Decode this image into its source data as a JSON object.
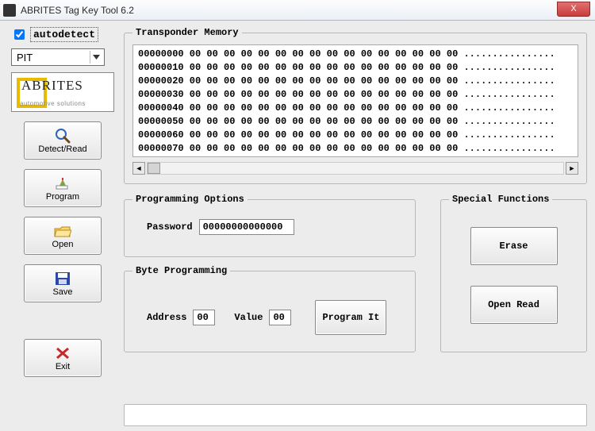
{
  "window": {
    "title": "ABRITES Tag Key Tool 6.2",
    "close": "X"
  },
  "left": {
    "autodetect_label": "autodetect",
    "autodetect_checked": true,
    "combo_value": "PIT",
    "logo_main": "ABRITES",
    "logo_sub": "automotive solutions",
    "buttons": {
      "detect": "Detect/Read",
      "program": "Program",
      "open": "Open",
      "save": "Save",
      "exit": "Exit"
    }
  },
  "memory": {
    "legend": "Transponder Memory",
    "rows": [
      "00000000 00 00 00 00 00 00 00 00 00 00 00 00 00 00 00 00 ................",
      "00000010 00 00 00 00 00 00 00 00 00 00 00 00 00 00 00 00 ................",
      "00000020 00 00 00 00 00 00 00 00 00 00 00 00 00 00 00 00 ................",
      "00000030 00 00 00 00 00 00 00 00 00 00 00 00 00 00 00 00 ................",
      "00000040 00 00 00 00 00 00 00 00 00 00 00 00 00 00 00 00 ................",
      "00000050 00 00 00 00 00 00 00 00 00 00 00 00 00 00 00 00 ................",
      "00000060 00 00 00 00 00 00 00 00 00 00 00 00 00 00 00 00 ................",
      "00000070 00 00 00 00 00 00 00 00 00 00 00 00 00 00 00 00 ................"
    ]
  },
  "prog_options": {
    "legend": "Programming Options",
    "password_label": "Password",
    "password_value": "00000000000000"
  },
  "special": {
    "legend": "Special Functions",
    "erase": "Erase",
    "open_read": "Open Read"
  },
  "byte_prog": {
    "legend": "Byte Programming",
    "address_label": "Address",
    "address_value": "00",
    "value_label": "Value",
    "value_value": "00",
    "program_it": "Program It"
  }
}
